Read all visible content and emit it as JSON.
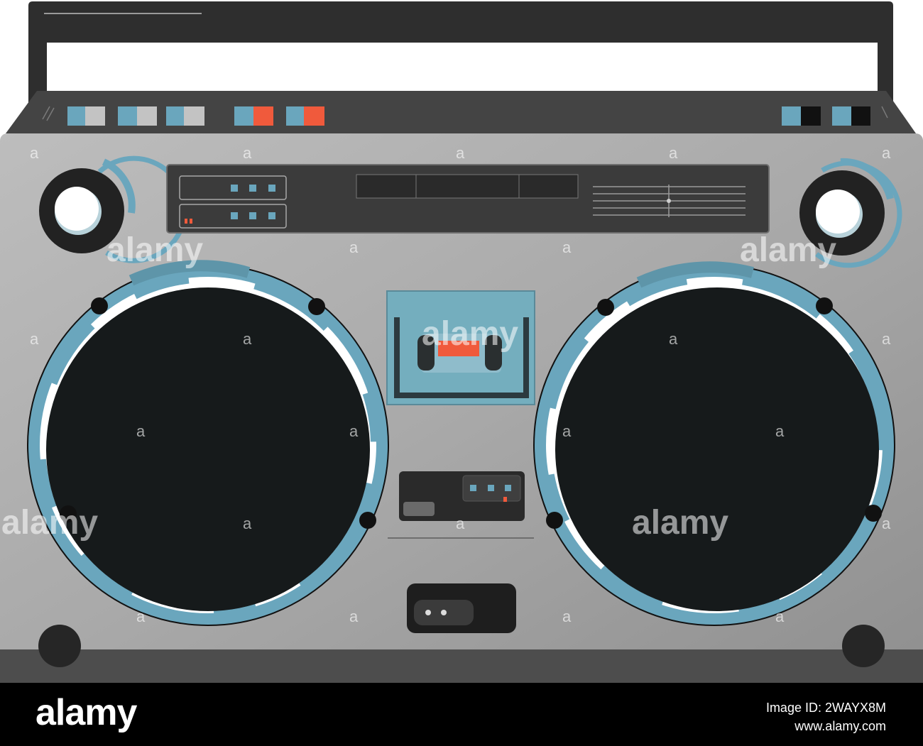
{
  "colors": {
    "body_light": "#b7b7b7",
    "body_dark": "#8e8e8e",
    "frame": "#4a4a4a",
    "handle": "#2e2e2e",
    "accent_blue": "#6aa6bd",
    "speaker": "#161a1b",
    "button_red": "#f05a3c",
    "footer_bg": "#000000"
  },
  "footer": {
    "brand": "alamy",
    "image_id_label": "Image ID: 2WAYX8M",
    "site": "www.alamy.com"
  },
  "watermark": {
    "brand": "alamy",
    "mark": "a"
  },
  "icons": {
    "left_knob": "volume-knob-icon",
    "right_knob": "tuning-knob-icon",
    "cassette": "cassette-icon",
    "power_switch": "switch-icon"
  }
}
